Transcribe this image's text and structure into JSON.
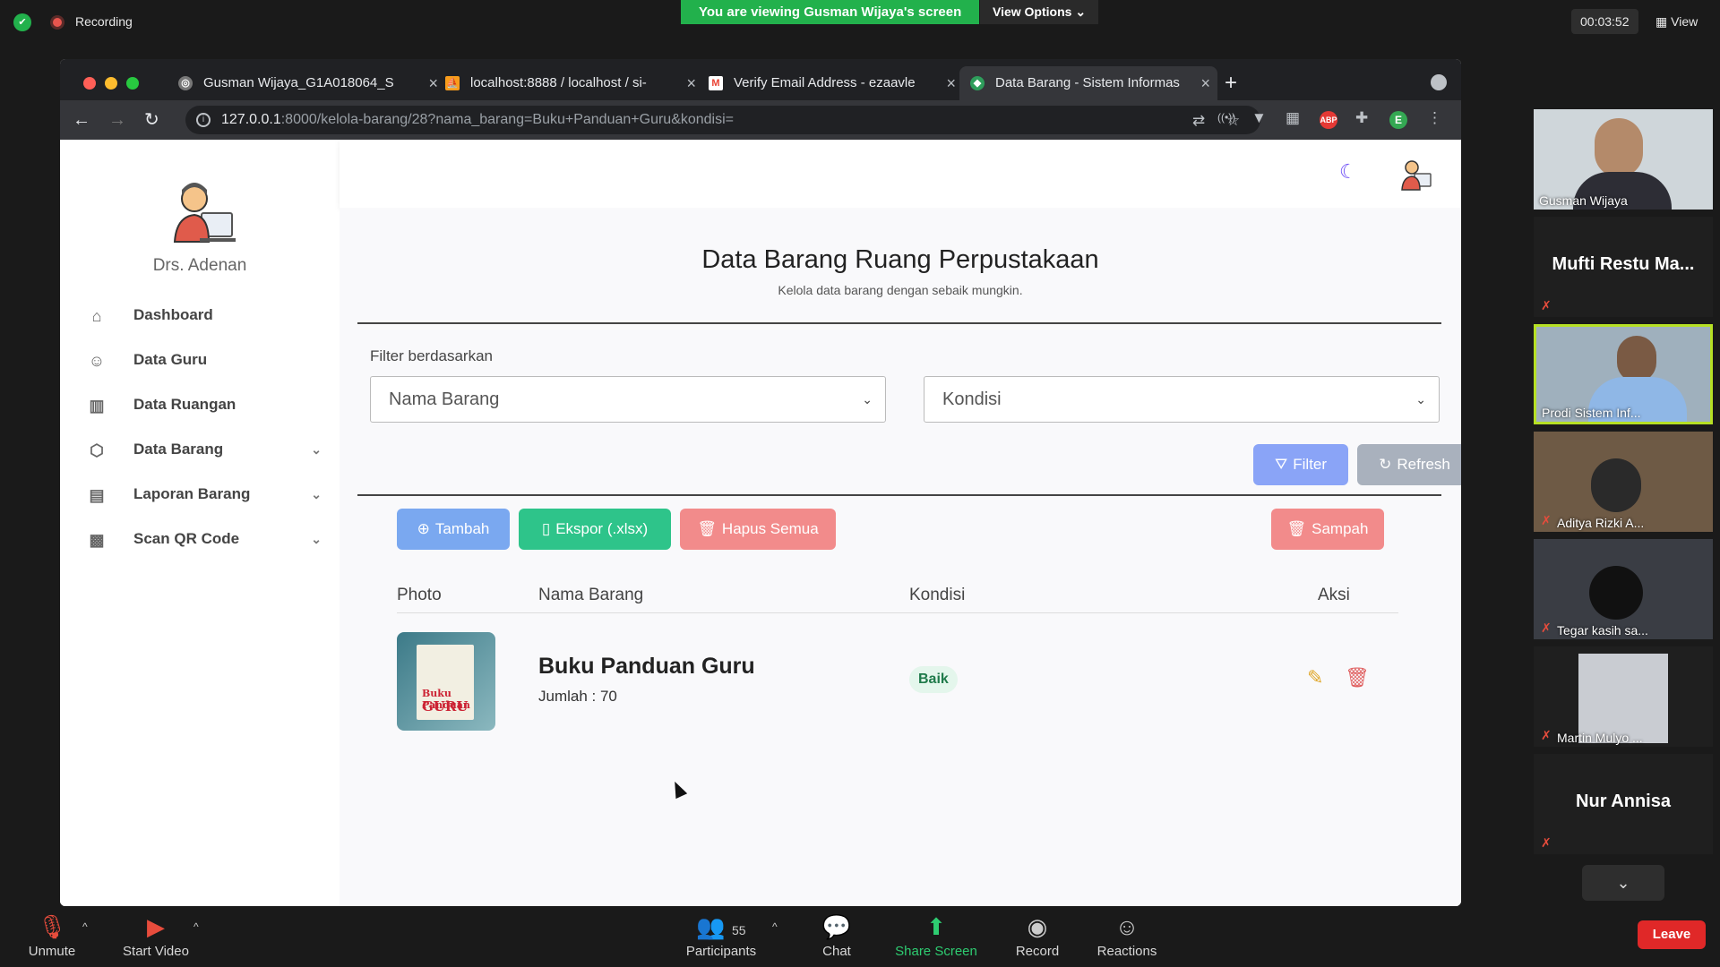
{
  "zoom": {
    "recording_label": "Recording",
    "viewing_banner": "You are viewing Gusman Wijaya's screen",
    "view_options": "View Options",
    "timer": "00:03:52",
    "view_label": "View",
    "toolbar": {
      "unmute": "Unmute",
      "start_video": "Start Video",
      "participants_count": "55",
      "participants": "Participants",
      "chat": "Chat",
      "share_screen": "Share Screen",
      "record": "Record",
      "reactions": "Reactions",
      "leave": "Leave"
    },
    "participants": [
      {
        "name": "Gusman Wijaya"
      },
      {
        "name": "Mufti  Restu  Ma..."
      },
      {
        "name": "Prodi  Sistem Inf..."
      },
      {
        "name": "Aditya Rizki A..."
      },
      {
        "name": "Tegar kasih sa..."
      },
      {
        "name": "Martin Mulyo ..."
      },
      {
        "name": "Nur Annisa"
      }
    ]
  },
  "browser": {
    "tabs": [
      {
        "title": "Gusman Wijaya_G1A018064_S"
      },
      {
        "title": "localhost:8888 / localhost / si-"
      },
      {
        "title": "Verify Email Address - ezaavle"
      },
      {
        "title": "Data Barang - Sistem Informas"
      }
    ],
    "url_host": "127.0.0.1",
    "url_rest": ":8000/kelola-barang/28?nama_barang=Buku+Panduan+Guru&kondisi=",
    "profile_initial": "E",
    "abp_label": "ABP"
  },
  "app": {
    "user_name": "Drs. Adenan",
    "nav": [
      {
        "label": "Dashboard",
        "icon": "home-icon"
      },
      {
        "label": "Data Guru",
        "icon": "users-icon"
      },
      {
        "label": "Data Ruangan",
        "icon": "building-icon"
      },
      {
        "label": "Data Barang",
        "icon": "box-icon"
      },
      {
        "label": "Laporan Barang",
        "icon": "report-icon"
      },
      {
        "label": "Scan QR Code",
        "icon": "qr-icon"
      }
    ],
    "page_title": "Data Barang Ruang Perpustakaan",
    "page_subtitle": "Kelola data barang dengan sebaik mungkin.",
    "filter_label": "Filter berdasarkan",
    "select_nama": "Nama Barang",
    "select_kondisi": "Kondisi",
    "btn_filter": "Filter",
    "btn_refresh": "Refresh",
    "btn_tambah": "Tambah",
    "btn_ekspor": "Ekspor (.xlsx)",
    "btn_hapus": "Hapus Semua",
    "btn_sampah": "Sampah",
    "columns": {
      "photo": "Photo",
      "nama": "Nama Barang",
      "kondisi": "Kondisi",
      "aksi": "Aksi"
    },
    "rows": [
      {
        "nama": "Buku Panduan Guru",
        "jumlah": "Jumlah : 70",
        "kondisi": "Baik",
        "book_line1": "Buku Panduan",
        "book_line2": "GURU"
      }
    ],
    "colors": {
      "filter": "#8aa4f7",
      "refresh": "#a9b1bd",
      "tambah": "#7aa8f0",
      "ekspor": "#2ec48a",
      "hapus": "#f28b8b",
      "sampah": "#f28b8b",
      "moon": "#6b4cf6"
    }
  }
}
